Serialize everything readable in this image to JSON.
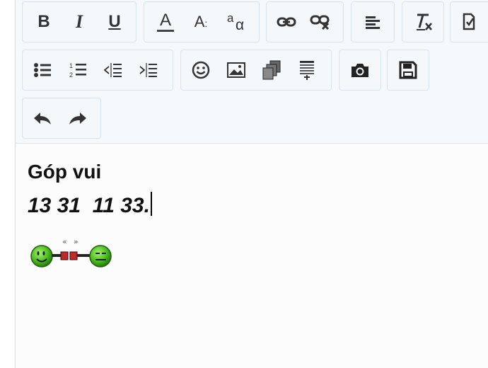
{
  "editor": {
    "content": {
      "heading": "Góp vui",
      "numbers": "13 31  11 33."
    },
    "toolbar": {
      "bold": "B",
      "italic": "I",
      "underline": "U",
      "font_color": "A",
      "font_size": "A",
      "subscript_main": "a",
      "subscript_sub": "α"
    },
    "icons": [
      "bold-icon",
      "italic-icon",
      "underline-icon",
      "font-color-icon",
      "font-size-icon",
      "subscript-icon",
      "link-icon",
      "unlink-icon",
      "align-left-icon",
      "clear-format-icon",
      "paint-icon",
      "bullet-list-icon",
      "numbered-list-icon",
      "outdent-icon",
      "indent-icon",
      "emoji-icon",
      "image-icon",
      "copy-icon",
      "template-icon",
      "camera-icon",
      "save-icon",
      "undo-icon",
      "redo-icon"
    ]
  }
}
